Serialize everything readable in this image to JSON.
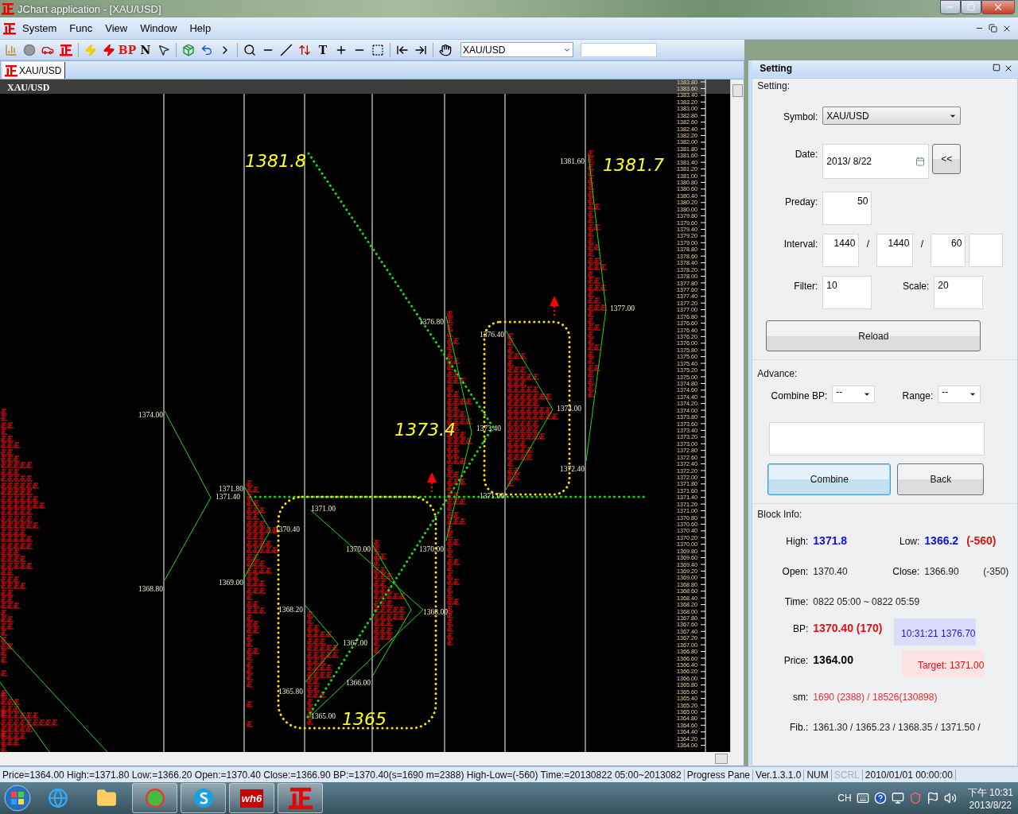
{
  "window": {
    "title": "JChart application - [XAU/USD]"
  },
  "menu": [
    "System",
    "Func",
    "View",
    "Window",
    "Help"
  ],
  "toolbar": {
    "buttons": [
      {
        "kind": "icon"
      },
      {
        "kind": "icon"
      },
      {
        "kind": "icon"
      },
      {
        "kind": "icon"
      },
      {
        "kind": "icon"
      },
      {
        "kind": "icon"
      },
      {
        "kind": "text",
        "label": "BP",
        "color": "#ee1111"
      },
      {
        "kind": "text",
        "label": "N",
        "color": "#000000"
      },
      {
        "kind": "icon"
      },
      {
        "kind": "icon"
      },
      {
        "kind": "icon"
      },
      {
        "kind": "icon"
      },
      {
        "kind": "icon"
      },
      {
        "kind": "icon"
      },
      {
        "kind": "icon"
      },
      {
        "kind": "icon"
      },
      {
        "kind": "text",
        "label": "T",
        "color": "#000000"
      },
      {
        "kind": "icon"
      },
      {
        "kind": "icon"
      },
      {
        "kind": "icon"
      },
      {
        "kind": "icon"
      },
      {
        "kind": "icon"
      },
      {
        "kind": "icon"
      }
    ],
    "symbol": "XAU/USD"
  },
  "tab": {
    "label": "XAU/USD"
  },
  "chart": {
    "header": "XAU/USD",
    "big_labels": [
      "1381.8",
      "1381.7",
      "1373.4",
      "1365"
    ],
    "price_labels": [
      "1381.60",
      "1376.80",
      "1376.40",
      "1374.00",
      "1377.00",
      "1374.00",
      "1373.40",
      "1372.40",
      "1371.80",
      "1371.40",
      "1371.00",
      "1371.00",
      "1370.40",
      "1370.00",
      "1370.00",
      "1369.00",
      "1368.80",
      "1368.20",
      "1368.00",
      "1367.00",
      "1366.00",
      "1365.80",
      "1365.00"
    ],
    "axis_labels": [
      "1383.80",
      "1383.60",
      "1383.40",
      "1383.20",
      "1383.00",
      "1382.80",
      "1382.60",
      "1382.40",
      "1382.20",
      "1382.00",
      "1381.80",
      "1381.60",
      "1381.40",
      "1381.20",
      "1381.00",
      "1380.80",
      "1380.60",
      "1380.40",
      "1380.20",
      "1380.00",
      "1379.80",
      "1379.60",
      "1379.40",
      "1379.20",
      "1379.00",
      "1378.80",
      "1378.60",
      "1378.40",
      "1378.20",
      "1378.00",
      "1377.80",
      "1377.60",
      "1377.40",
      "1377.20",
      "1377.00",
      "1376.80",
      "1376.60",
      "1376.40",
      "1376.20",
      "1376.00",
      "1375.80",
      "1375.60",
      "1375.40",
      "1375.20",
      "1375.00",
      "1374.80",
      "1374.60",
      "1374.40",
      "1374.20",
      "1374.00",
      "1373.80",
      "1373.60",
      "1373.40",
      "1373.20",
      "1373.00",
      "1372.80",
      "1372.60",
      "1372.40",
      "1372.20",
      "1372.00",
      "1371.80",
      "1371.60",
      "1371.40",
      "1371.20",
      "1371.00",
      "1370.80",
      "1370.60",
      "1370.40",
      "1370.20",
      "1370.00",
      "1369.80",
      "1369.60",
      "1369.40",
      "1369.20",
      "1369.00",
      "1368.80",
      "1368.60",
      "1368.40",
      "1368.20",
      "1368.00",
      "1367.80",
      "1367.60",
      "1367.40",
      "1367.20",
      "1367.00",
      "1366.80",
      "1366.60",
      "1366.40",
      "1366.20",
      "1366.00",
      "1365.80",
      "1365.60",
      "1365.40",
      "1365.20",
      "1365.00",
      "1364.80",
      "1364.60",
      "1364.40",
      "1364.20",
      "1364.00"
    ]
  },
  "panel": {
    "title": "Setting",
    "setting": {
      "legend": "Setting:",
      "symbol_label": "Symbol:",
      "symbol": "XAU/USD",
      "date_label": "Date:",
      "date": "2013/  8/22",
      "back_button": "<<",
      "preday_label": "Preday:",
      "preday": "50",
      "interval_label": "Interval:",
      "interval": [
        "1440",
        "1440",
        "60"
      ],
      "separators": [
        "/",
        "/"
      ],
      "filter_label": "Filter:",
      "filter": "10",
      "scale_label": "Scale:",
      "scale": "20",
      "reload_button": "Reload"
    },
    "advance": {
      "legend": "Advance:",
      "combine_bp_label": "Combine BP:",
      "combine_bp": "--",
      "range_label": "Range:",
      "range": "--",
      "buttons": [
        {
          "label": "Combine",
          "focused": true
        },
        {
          "label": "Back",
          "focused": false
        }
      ]
    },
    "block_info": {
      "legend": "Block Info:",
      "high_label": "High:",
      "high": "1371.8",
      "low_label": "Low:",
      "low": "1366.2",
      "low_diff": "(-560)",
      "open_label": "Open:",
      "open": "1370.40",
      "close_label": "Close:",
      "close": "1366.90",
      "close_diff": "(-350)",
      "time_label": "Time:",
      "time": "0822 05:00 ~ 0822 05:59",
      "bp_label": "BP:",
      "bp": "1370.40 (170)",
      "quote": "10:31:21  1376.70",
      "price_label": "Price:",
      "price": "1364.00",
      "target": "Target: 1371.00",
      "sm_label": "sm:",
      "sm": "1690 (2388) / 18526(130898)",
      "fib_label": "Fib.:",
      "fib": "1361.30 / 1365.23 / 1368.35 / 1371.50 /"
    }
  },
  "status_bar": [
    {
      "text": "Price=1364.00  High:=1371.80  Low:=1366.20  Open:=1370.40  Close:=1366.90  BP:=1370.40(s=1690 m=2388)  High-Low=(-560)  Time:=20130822 05:00~2013082",
      "disabled": false
    },
    {
      "text": "Progress Pane",
      "disabled": false
    },
    {
      "text": "Ver.1.3.1.0",
      "disabled": false
    },
    {
      "text": "NUM",
      "disabled": false
    },
    {
      "text": "SCRL",
      "disabled": true
    },
    {
      "text": "2010/01/01 00:00:00",
      "disabled": false
    }
  ],
  "taskbar": {
    "app_label": "wh6",
    "lang": "CH",
    "time": "下午 10:31",
    "date": "2013/8/22"
  }
}
